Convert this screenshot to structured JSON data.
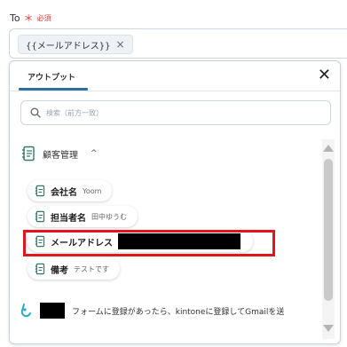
{
  "field": {
    "label": "To",
    "required_mark": "＊",
    "required_text": "必須",
    "chip_text": "{{メールアドレス}}",
    "chip_close": "×"
  },
  "panel": {
    "tab_label": "アウトプット",
    "close_glyph": "✕",
    "search_placeholder": "検索（前方一致）",
    "section_title": "顧客管理",
    "section_chevron": "^",
    "items": [
      {
        "label": "会社名",
        "value": "Yoom"
      },
      {
        "label": "担当者名",
        "value": "田中ゆうむ"
      },
      {
        "label": "メールアドレス",
        "value": ""
      },
      {
        "label": "備考",
        "value": "テストです"
      }
    ],
    "footer_text": "フォームに登録があったら、kintoneに登録してGmailを送"
  },
  "colors": {
    "accent": "#2f6f9f",
    "highlight": "#e0161f",
    "required": "#e53935"
  }
}
